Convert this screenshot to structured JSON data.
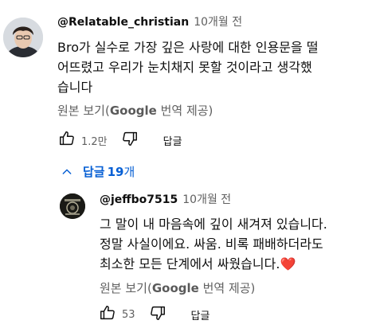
{
  "comment": {
    "author": "@Relatable_christian",
    "time": "10개월 전",
    "lines": [
      "Bro가 실수로 가장 깊은 사랑에 대한 인용문을 떨",
      "어뜨렸고 우리가 눈치채지 못할 것이라고 생각했",
      "습니다"
    ],
    "translate_prefix": "원본 보기(",
    "translate_strong": "Google",
    "translate_suffix": " 번역 제공)",
    "likes": "1.2만",
    "reply_label": "답글"
  },
  "replies_toggle": {
    "label": "답글",
    "count": "19",
    "suffix": "개"
  },
  "reply": {
    "author": "@jeffbo7515",
    "time": "10개월 전",
    "lines": [
      "그 말이 내 마음속에 깊이 새겨져 있습니다.",
      "정말 사실이에요. 싸움. 비록 패배하더라도",
      "최소한 모든 단계에서 싸웠습니다."
    ],
    "heart": "❤️",
    "translate_prefix": "원본 보기(",
    "translate_strong": "Google",
    "translate_suffix": " 번역 제공)",
    "likes": "53",
    "reply_label": "답글"
  },
  "colors": {
    "link_blue": "#065fd4",
    "secondary_text": "#606060",
    "heart_red": "#e0245e"
  },
  "icons": {
    "like": "thumbs-up-outline",
    "dislike": "thumbs-down-outline",
    "collapse": "chevron-up"
  }
}
